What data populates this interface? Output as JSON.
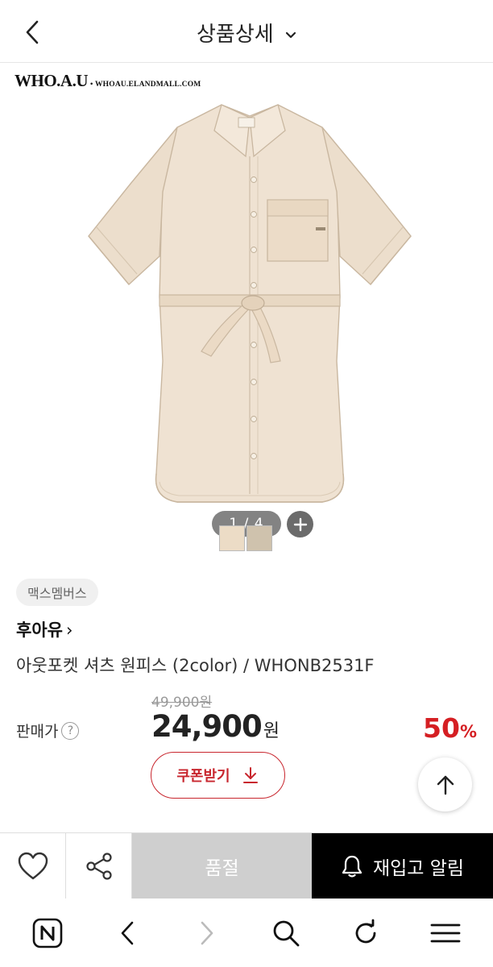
{
  "header": {
    "title": "상품상세"
  },
  "product_image": {
    "brand_logo": "WHO.A.U",
    "brand_url": "WHOAU.ELANDMALL.COM",
    "page_indicator": "1 / 4"
  },
  "swatches": [
    "#ecdcc6",
    "#cfc2ad"
  ],
  "info": {
    "badge": "맥스멤버스",
    "brand_name": "후아유",
    "brand_arrow": "›",
    "product_name": "아웃포켓 셔츠 원피스 (2color) / WHONB2531F"
  },
  "pricing": {
    "original_price": "49,900원",
    "price_label": "판매가",
    "help_mark": "?",
    "sale_price": "24,900",
    "currency": "원",
    "discount": "50",
    "discount_unit": "%"
  },
  "coupon": {
    "label": "쿠폰받기"
  },
  "action_bar": {
    "soldout_label": "품절",
    "restock_label": "재입고 알림"
  },
  "colors": {
    "accent_red": "#d51f23",
    "coupon_red": "#c8262e",
    "soldout_gray": "#cfcfcf",
    "garment_beige": "#efe2d2"
  }
}
